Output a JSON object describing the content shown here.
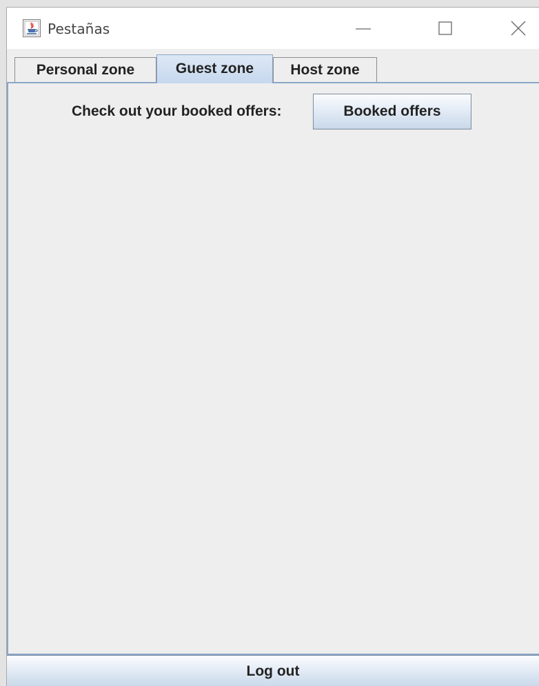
{
  "window": {
    "title": "Pestañas",
    "icon": "java-cup-icon",
    "controls": [
      "minimize-icon",
      "maximize-icon",
      "close-icon"
    ]
  },
  "tabs": [
    {
      "label": "Personal zone",
      "selected": false
    },
    {
      "label": "Guest zone",
      "selected": true
    },
    {
      "label": "Host zone",
      "selected": false
    }
  ],
  "guest_zone": {
    "booked_label": "Check out your booked offers:",
    "booked_button": "Booked offers"
  },
  "footer": {
    "logout_button": "Log out"
  },
  "colors": {
    "tab_selected": "#c6d8ee",
    "panel_border": "#8aa6c8",
    "background": "#eeeeee"
  }
}
